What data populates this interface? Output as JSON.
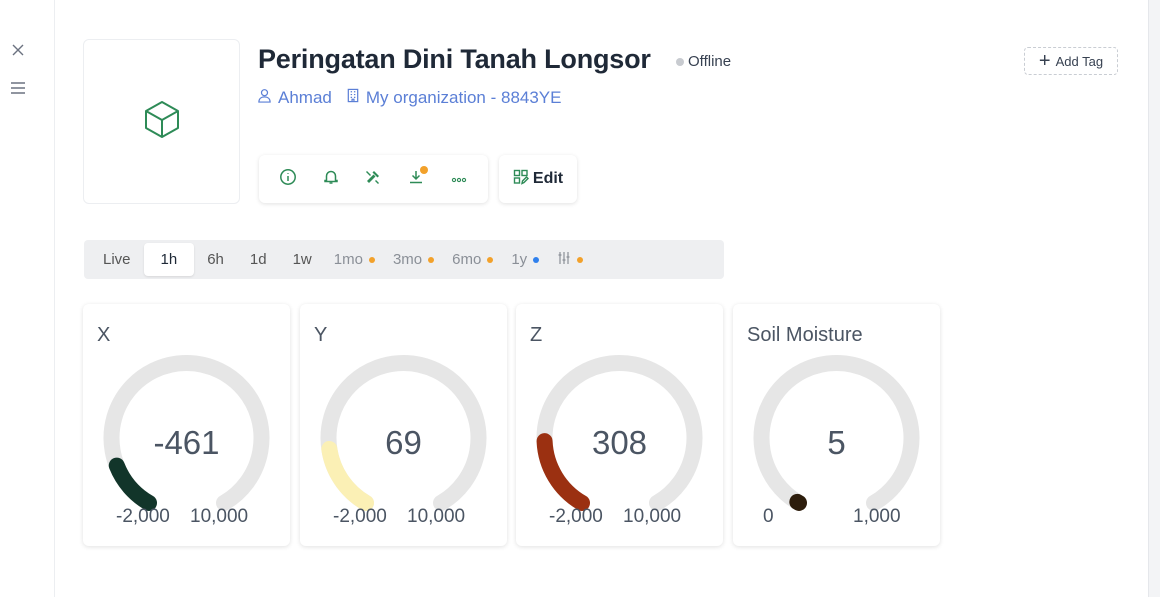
{
  "device": {
    "name": "Peringatan Dini Tanah Longsor",
    "status": "Offline",
    "owner": "Ahmad",
    "organization": "My organization - 8843YE"
  },
  "actions": {
    "edit_label": "Edit",
    "add_tag_label": "Add Tag"
  },
  "time_ranges": [
    {
      "label": "Live",
      "active": false,
      "dot": null
    },
    {
      "label": "1h",
      "active": true,
      "dot": null
    },
    {
      "label": "6h",
      "active": false,
      "dot": null
    },
    {
      "label": "1d",
      "active": false,
      "dot": null
    },
    {
      "label": "1w",
      "active": false,
      "dot": null
    },
    {
      "label": "1mo",
      "active": false,
      "dot": "#f2a12b"
    },
    {
      "label": "3mo",
      "active": false,
      "dot": "#f2a12b"
    },
    {
      "label": "6mo",
      "active": false,
      "dot": "#f2a12b"
    },
    {
      "label": "1y",
      "active": false,
      "dot": "#2f80ed"
    },
    {
      "label": "",
      "active": false,
      "dot": "#f2a12b",
      "icon": "sliders-icon"
    }
  ],
  "widgets": [
    {
      "title": "X",
      "value": "-461",
      "min": "-2,000",
      "max": "10,000",
      "fraction": 0.128,
      "color": "#12352a"
    },
    {
      "title": "Y",
      "value": "69",
      "min": "-2,000",
      "max": "10,000",
      "fraction": 0.172,
      "color": "#fbf0b5"
    },
    {
      "title": "Z",
      "value": "308",
      "min": "-2,000",
      "max": "10,000",
      "fraction": 0.192,
      "color": "#9b3011"
    },
    {
      "title": "Soil Moisture",
      "value": "5",
      "min": "0",
      "max": "1,000",
      "fraction": 0.005,
      "color": "#2d1d0c"
    }
  ],
  "colors": {
    "accent": "#2e8b57",
    "link": "#5b7fd6",
    "badge": "#f2a12b",
    "gauge_track": "#e6e6e6"
  }
}
